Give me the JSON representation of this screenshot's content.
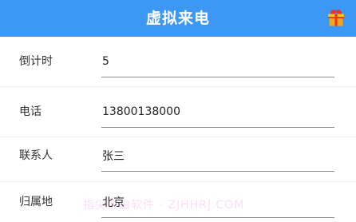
{
  "header": {
    "title": "虚拟来电",
    "gift_icon": "gift-icon",
    "background": "#3d97f5"
  },
  "form": {
    "fields": [
      {
        "label": "倒计时",
        "value": "5"
      },
      {
        "label": "电话",
        "value": "13800138000"
      },
      {
        "label": "联系人",
        "value": "张三"
      },
      {
        "label": "归属地",
        "value": "北京"
      }
    ]
  },
  "watermark": "指尖自由软件 · ZJHHRJ.COM"
}
